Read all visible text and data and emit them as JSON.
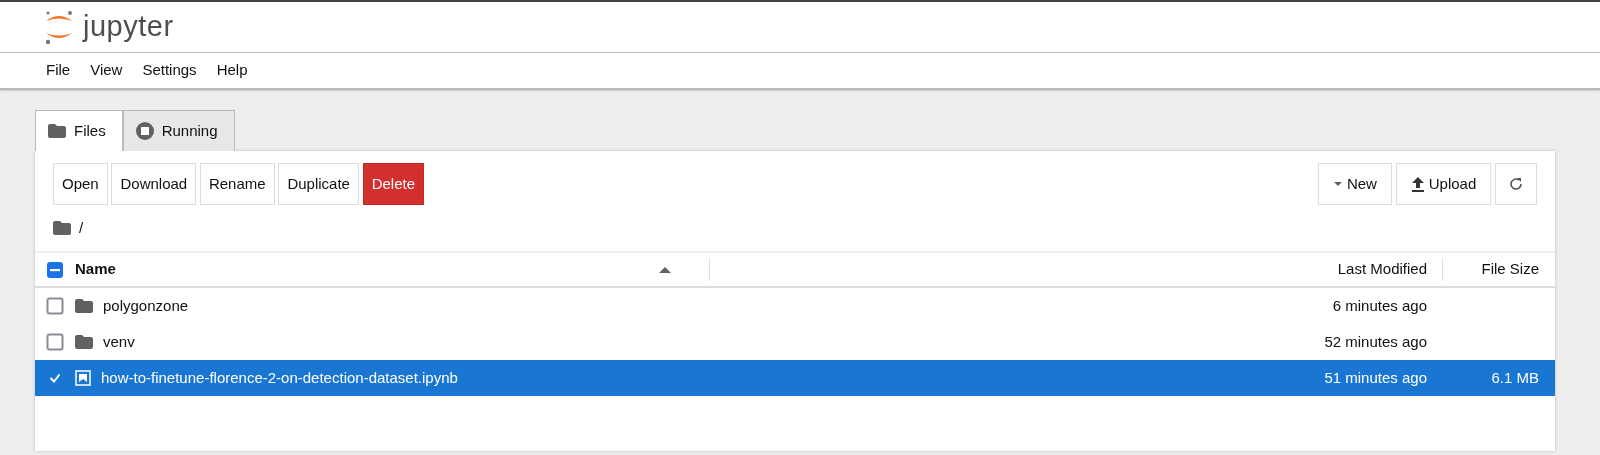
{
  "app": {
    "logo_text": "jupyter"
  },
  "menu": [
    "File",
    "View",
    "Settings",
    "Help"
  ],
  "tabs": [
    {
      "label": "Files",
      "kind": "folder",
      "selected": true
    },
    {
      "label": "Running",
      "kind": "stop",
      "selected": false
    }
  ],
  "toolbar": {
    "actions": [
      {
        "label": "Open",
        "kind": "plain"
      },
      {
        "label": "Download",
        "kind": "plain"
      },
      {
        "label": "Rename",
        "kind": "plain"
      },
      {
        "label": "Duplicate",
        "kind": "plain"
      },
      {
        "label": "Delete",
        "kind": "danger"
      }
    ],
    "right": [
      {
        "label": "New",
        "kind": "caret"
      },
      {
        "label": "Upload",
        "kind": "upload"
      },
      {
        "kind": "refresh"
      }
    ]
  },
  "breadcrumb": "/",
  "table": {
    "select_all": {
      "indeterminate": true
    },
    "columns": [
      "Name",
      "Last Modified",
      "File Size"
    ],
    "rows": [
      {
        "kind": "folder",
        "name": "polygonzone",
        "modified": "6 minutes ago",
        "selected": false
      },
      {
        "kind": "folder",
        "name": "venv",
        "modified": "52 minutes ago",
        "selected": false
      },
      {
        "kind": "notebook",
        "name": "how-to-finetune-florence-2-on-detection-dataset.ipynb",
        "modified": "51 minutes ago",
        "size": "6.1 MB",
        "selected": true
      }
    ]
  }
}
